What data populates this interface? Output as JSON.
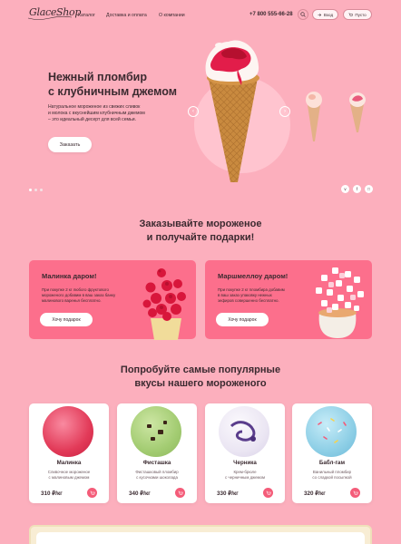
{
  "header": {
    "logo_text": "GlaceShop",
    "nav": [
      "Каталог",
      "Доставка и оплата",
      "О компании"
    ],
    "phone": "+7 800 555-66-28",
    "login_label": "Вход",
    "cart_label": "Пусто"
  },
  "hero": {
    "title_line1": "Нежный пломбир",
    "title_line2": "с клубничным джемом",
    "desc_line1": "Натуральное мороженое из свежих сливок",
    "desc_line2": "и молока с вкуснейшим клубничным джемом",
    "desc_line3": "– это идеальный десерт для всей семьи.",
    "order_label": "Заказать"
  },
  "gifts": {
    "title_line1": "Заказывайте мороженое",
    "title_line2": "и получайте подарки!",
    "promos": [
      {
        "title": "Малинка даром!",
        "line1": "При покупке 2 кг любого фруктового",
        "line2": "мороженого добавим в ваш заказ банку",
        "line3": "малинового варенья бесплатно.",
        "button": "Хочу подарок"
      },
      {
        "title": "Маршмеллоу даром!",
        "line1": "При покупке 2 кг пломбира добавим",
        "line2": "в ваш заказ упаковку нежных",
        "line3": "зефиров совершенно бесплатно.",
        "button": "Хочу подарок"
      }
    ]
  },
  "popular": {
    "title_line1": "Попробуйте самые популярные",
    "title_line2": "вкусы нашего мороженого",
    "products": [
      {
        "name": "Малинка",
        "desc1": "Сливочное мороженое",
        "desc2": "с малиновым джемом",
        "price": "310 ₽/кг",
        "color": "#e94b66"
      },
      {
        "name": "Фисташка",
        "desc1": "Фисташковый пломбир",
        "desc2": "с кусочками шоколада",
        "price": "340 ₽/кг",
        "color": "#a8cf7a"
      },
      {
        "name": "Черника",
        "desc1": "Крем-брюле",
        "desc2": "с черничным джемом",
        "price": "330 ₽/кг",
        "color": "#e9e4f2"
      },
      {
        "name": "Бабл-гам",
        "desc1": "Ванильный пломбир",
        "desc2": "со сладкой посыпкой",
        "price": "320 ₽/кг",
        "color": "#8ecfe6"
      }
    ]
  },
  "colors": {
    "background": "#fcafbd",
    "promo": "#fc6f8c",
    "accent": "#f45c79",
    "text": "#3b2a30"
  }
}
